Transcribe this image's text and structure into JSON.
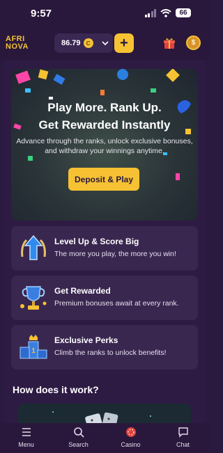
{
  "status_bar": {
    "time": "9:57",
    "battery": "66"
  },
  "header": {
    "logo_line1": "AFRI",
    "logo_line2": "NOVA",
    "balance": "86.79",
    "currency_icon": "coin-icon",
    "add_label": "+"
  },
  "hero": {
    "title_line1": "Play More. Rank Up.",
    "title_line2": "Get Rewarded Instantly",
    "subtitle_line1": "Advance through the ranks, unlock exclusive bonuses,",
    "subtitle_line2": "and withdraw your winnings anytime.",
    "button_label": "Deposit & Play"
  },
  "features": [
    {
      "icon": "level-up-arrow-icon",
      "title": "Level Up & Score Big",
      "desc": "The more you play, the more you win!"
    },
    {
      "icon": "trophy-icon",
      "title": "Get Rewarded",
      "desc": "Premium bonuses await at every rank."
    },
    {
      "icon": "podium-icon",
      "title": "Exclusive Perks",
      "desc": "Climb the ranks to unlock benefits!"
    }
  ],
  "how_it_works": {
    "title": "How does it work?"
  },
  "bottom_nav": [
    {
      "icon": "menu-icon",
      "label": "Menu"
    },
    {
      "icon": "search-icon",
      "label": "Search"
    },
    {
      "icon": "casino-chip-icon",
      "label": "Casino"
    },
    {
      "icon": "chat-icon",
      "label": "Chat"
    }
  ],
  "colors": {
    "accent": "#f6c233",
    "background": "#2b1a3f",
    "card": "#3a2750"
  }
}
